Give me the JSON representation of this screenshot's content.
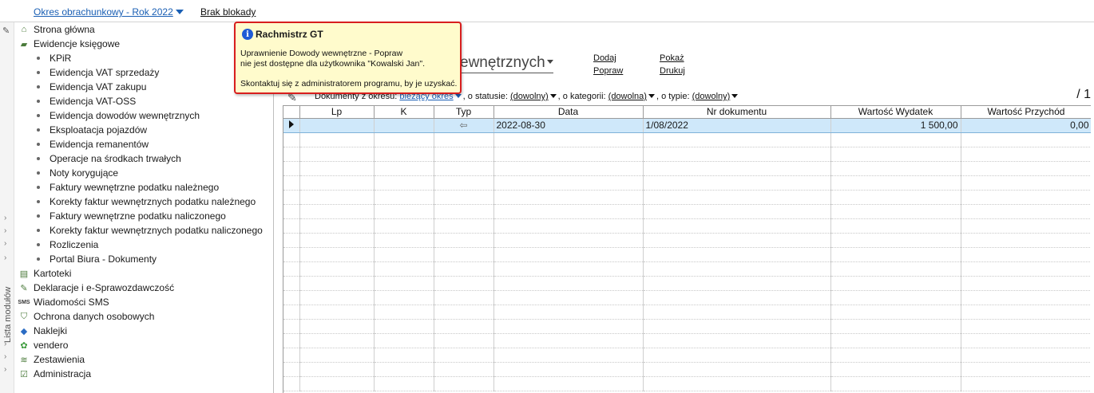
{
  "topbar": {
    "period_label": "Okres obrachunkowy - Rok 2022",
    "lock_label": "Brak blokady"
  },
  "left_strip": {
    "vertical_label": "Lista modułów"
  },
  "sidebar": {
    "items": [
      {
        "label": "Strona główna",
        "icon": "home-icon",
        "level": 0
      },
      {
        "label": "Ewidencje księgowe",
        "icon": "ledger-icon",
        "level": 0
      },
      {
        "label": "KPiR",
        "level": 1
      },
      {
        "label": "Ewidencja VAT sprzedaży",
        "level": 1
      },
      {
        "label": "Ewidencja VAT zakupu",
        "level": 1
      },
      {
        "label": "Ewidencja VAT-OSS",
        "level": 1
      },
      {
        "label": "Ewidencja dowodów wewnętrznych",
        "level": 1
      },
      {
        "label": "Eksploatacja pojazdów",
        "level": 1
      },
      {
        "label": "Ewidencja remanentów",
        "level": 1
      },
      {
        "label": "Operacje na środkach trwałych",
        "level": 1
      },
      {
        "label": "Noty korygujące",
        "level": 1
      },
      {
        "label": "Faktury wewnętrzne podatku należnego",
        "level": 1
      },
      {
        "label": "Korekty faktur wewnętrznych podatku należnego",
        "level": 1
      },
      {
        "label": "Faktury wewnętrzne podatku naliczonego",
        "level": 1
      },
      {
        "label": "Korekty faktur wewnętrznych podatku naliczonego",
        "level": 1
      },
      {
        "label": "Rozliczenia",
        "level": 1
      },
      {
        "label": "Portal Biura - Dokumenty",
        "level": 1
      },
      {
        "label": "Kartoteki",
        "icon": "folder-icon",
        "level": 0
      },
      {
        "label": "Deklaracje i e-Sprawozdawczość",
        "icon": "declaration-icon",
        "level": 0
      },
      {
        "label": "Wiadomości SMS",
        "icon": "sms-icon",
        "level": 0
      },
      {
        "label": "Ochrona danych osobowych",
        "icon": "shield-icon",
        "level": 0
      },
      {
        "label": "Naklejki",
        "icon": "sticker-icon",
        "level": 0
      },
      {
        "label": "vendero",
        "icon": "vendero-icon",
        "level": 0
      },
      {
        "label": "Zestawienia",
        "icon": "report-icon",
        "level": 0
      },
      {
        "label": "Administracja",
        "icon": "admin-icon",
        "level": 0
      }
    ]
  },
  "main": {
    "headline": "ewnętrznych",
    "actions": {
      "add": "Dodaj",
      "edit": "Popraw",
      "show": "Pokaż",
      "print": "Drukuj"
    },
    "filters": {
      "period_label": "Dokumenty z okresu:",
      "period_value": "bieżący okres",
      "status_label": ", o statusie:",
      "status_value": "(dowolny)",
      "category_label": ", o kategorii:",
      "category_value": "(dowolna)",
      "type_label": ", o typie:",
      "type_value": "(dowolny)"
    },
    "page_count": "/ 1",
    "table": {
      "columns": [
        "Lp",
        "K",
        "Typ",
        "Data",
        "Nr dokumentu",
        "Wartość Wydatek",
        "Wartość Przychód"
      ],
      "rows": [
        {
          "lp": "",
          "k": "",
          "typ": "⇦",
          "data": "2022-08-30",
          "nr": "1/08/2022",
          "wydatek": "1 500,00",
          "przychod": "0,00"
        }
      ]
    }
  },
  "tooltip": {
    "title": "Rachmistrz GT",
    "line1": "Uprawnienie Dowody wewnętrzne - Popraw",
    "line2": "nie jest dostępne dla użytkownika \"Kowalski Jan\".",
    "line3": "Skontaktuj się z administratorem programu, by je uzyskać."
  },
  "colors": {
    "link_blue": "#1a5fb4",
    "selection": "#cfe8fa",
    "tooltip_bg": "#fffbcc",
    "tooltip_border": "#d81e1e"
  }
}
